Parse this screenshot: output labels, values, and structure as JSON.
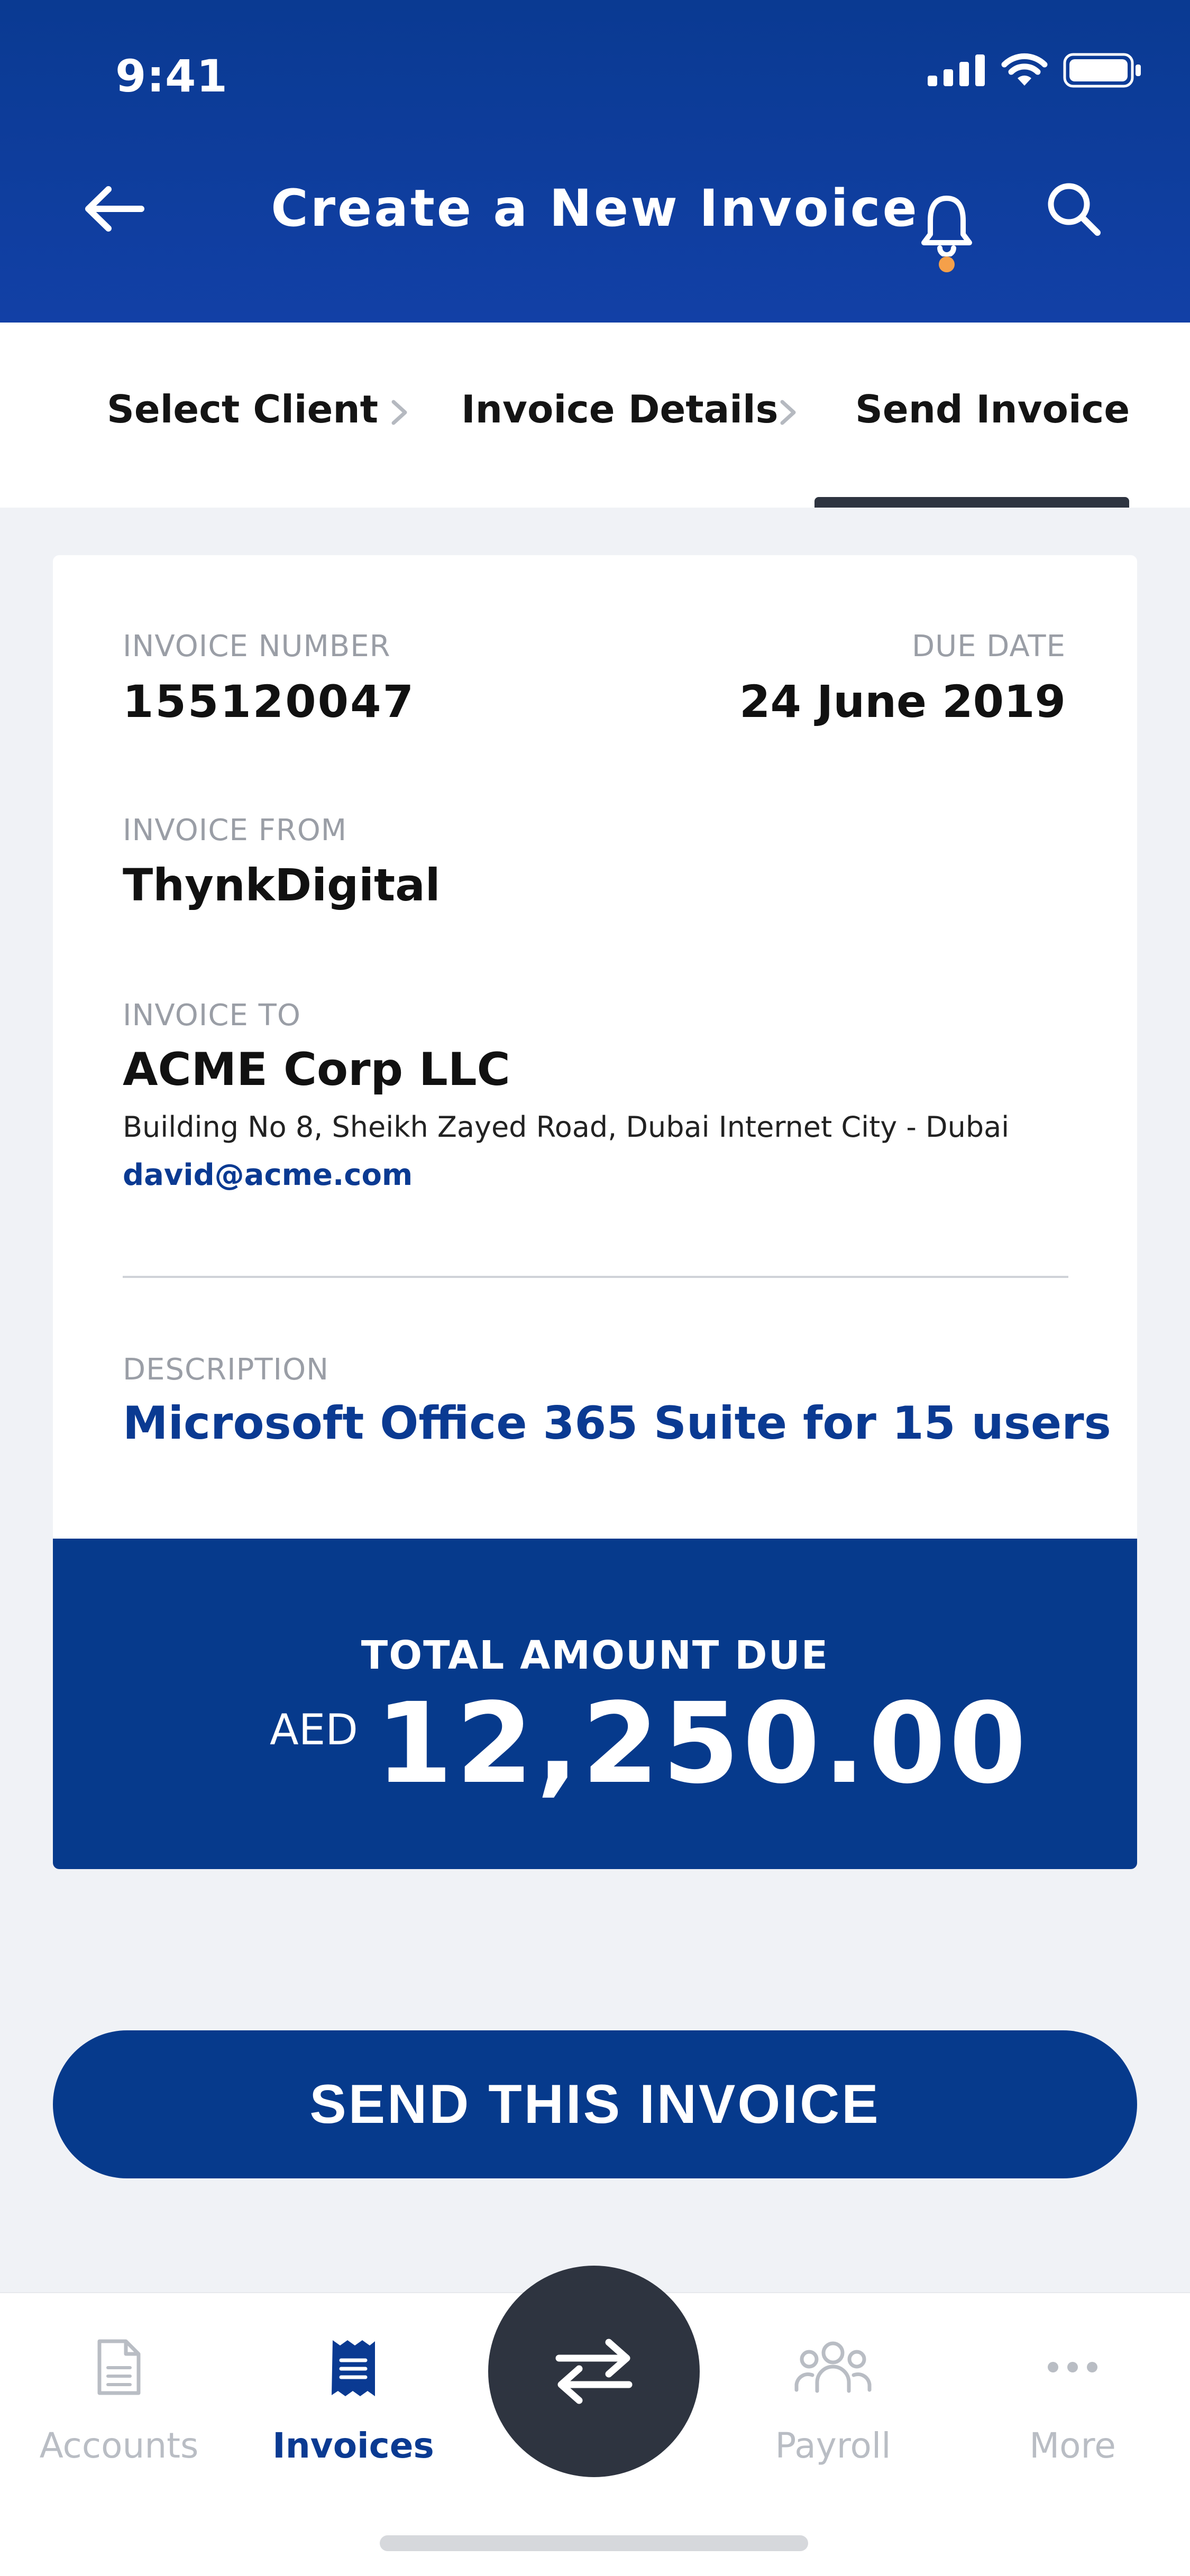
{
  "status_bar": {
    "time": "9:41"
  },
  "header": {
    "title": "Create a New Invoice"
  },
  "steps": [
    {
      "label": "Select Client"
    },
    {
      "label": "Invoice Details"
    },
    {
      "label": "Send Invoice"
    }
  ],
  "invoice": {
    "number_label": "INVOICE NUMBER",
    "number": "155120047",
    "due_label": "DUE DATE",
    "due_date": "24 June 2019",
    "from_label": "INVOICE FROM",
    "from": "ThynkDigital",
    "to_label": "INVOICE TO",
    "to_name": "ACME Corp LLC",
    "to_address": "Building No 8, Sheikh Zayed Road, Dubai Internet City - Dubai",
    "to_email": "david@acme.com",
    "description_label": "DESCRIPTION",
    "description": "Microsoft Office 365 Suite for 15 users"
  },
  "total": {
    "label": "TOTAL AMOUNT DUE",
    "currency": "AED",
    "amount": "12,250.00"
  },
  "actions": {
    "send_label": "SEND THIS INVOICE"
  },
  "tabbar": {
    "accounts": "Accounts",
    "invoices": "Invoices",
    "payroll": "Payroll",
    "more": "More"
  },
  "colors": {
    "brand": "#0a3a92",
    "dark": "#2e3440",
    "notification": "#f5a04a"
  }
}
